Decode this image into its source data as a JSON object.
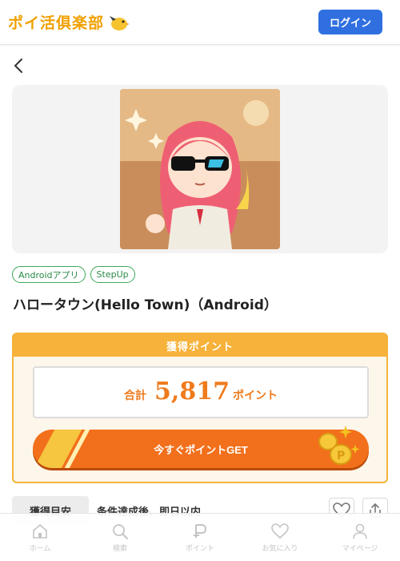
{
  "header": {
    "logo_text": "ポイ活俱楽部",
    "login_label": "ログイン"
  },
  "offer": {
    "tags": [
      "Androidアプリ",
      "StepUp"
    ],
    "title": "ハロータウン(Hello Town)（Android）"
  },
  "points": {
    "header_label": "獲得ポイント",
    "total_label": "合計",
    "total_value": "5,817",
    "unit": "ポイント",
    "get_button_label": "今すぐポイントGET"
  },
  "estimate": {
    "label": "獲得目安",
    "value": "条件達成後、即日以内"
  },
  "bottom_nav": {
    "items": [
      {
        "label": "ホーム",
        "icon": "home-icon"
      },
      {
        "label": "検索",
        "icon": "search-icon"
      },
      {
        "label": "ポイント",
        "icon": "point-icon"
      },
      {
        "label": "お気に入り",
        "icon": "heart-icon"
      },
      {
        "label": "マイページ",
        "icon": "user-icon"
      }
    ]
  },
  "colors": {
    "brand": "#f0a000",
    "login_button": "#2f6fe0",
    "tag_green": "#3da85a",
    "points_orange": "#f6b23a",
    "get_button": "#f2701c"
  }
}
